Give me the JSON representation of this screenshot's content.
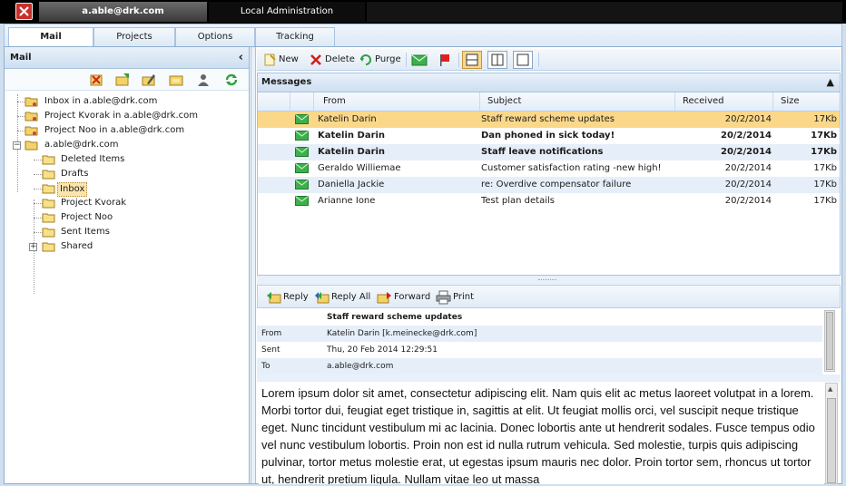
{
  "topbar": {
    "user": "a.able@drk.com",
    "admin": "Local Administration"
  },
  "tabs": [
    {
      "label": "Mail",
      "active": true
    },
    {
      "label": "Projects",
      "active": false
    },
    {
      "label": "Options",
      "active": false
    },
    {
      "label": "Tracking",
      "active": false
    }
  ],
  "left_panel": {
    "title": "Mail",
    "tree": [
      {
        "label": "Inbox in a.able@drk.com",
        "level": 0
      },
      {
        "label": "Project Kvorak in a.able@drk.com",
        "level": 0
      },
      {
        "label": "Project Noo in a.able@drk.com",
        "level": 0
      },
      {
        "label": "a.able@drk.com",
        "level": 0,
        "expanded": true
      },
      {
        "label": "Deleted Items",
        "level": 1
      },
      {
        "label": "Drafts",
        "level": 1
      },
      {
        "label": "Inbox",
        "level": 1,
        "selected": true
      },
      {
        "label": "Project Kvorak",
        "level": 1
      },
      {
        "label": "Project Noo",
        "level": 1
      },
      {
        "label": "Sent Items",
        "level": 1
      },
      {
        "label": "Shared",
        "level": 1,
        "collapsed": true
      }
    ]
  },
  "toolbar": {
    "new": "New",
    "delete": "Delete",
    "purge": "Purge"
  },
  "messages": {
    "title": "Messages",
    "columns": {
      "from": "From",
      "subject": "Subject",
      "received": "Received",
      "size": "Size"
    },
    "rows": [
      {
        "from": "Katelin Darin",
        "subject": "Staff reward scheme updates",
        "received": "20/2/2014",
        "size": "17Kb",
        "selected": true,
        "bold": false
      },
      {
        "from": "Katelin Darin",
        "subject": "Dan phoned in sick today!",
        "received": "20/2/2014",
        "size": "17Kb",
        "selected": false,
        "bold": true
      },
      {
        "from": "Katelin Darin",
        "subject": "Staff leave notifications",
        "received": "20/2/2014",
        "size": "17Kb",
        "selected": false,
        "bold": true
      },
      {
        "from": "Geraldo Williemae",
        "subject": "Customer satisfaction rating -new high!",
        "received": "20/2/2014",
        "size": "17Kb",
        "selected": false,
        "bold": false
      },
      {
        "from": "Daniella Jackie",
        "subject": "re: Overdive compensator failure",
        "received": "20/2/2014",
        "size": "17Kb",
        "selected": false,
        "bold": false
      },
      {
        "from": "Arianne Ione",
        "subject": "Test plan details",
        "received": "20/2/2014",
        "size": "17Kb",
        "selected": false,
        "bold": false
      }
    ]
  },
  "reading": {
    "reply": "Reply",
    "reply_all": "Reply All",
    "forward": "Forward",
    "print": "Print",
    "subject": "Staff reward scheme updates",
    "from_label": "From",
    "from_value": "Katelin Darin  [k.meinecke@drk.com]",
    "sent_label": "Sent",
    "sent_value": "Thu, 20 Feb 2014 12:29:51",
    "to_label": "To",
    "to_value": "a.able@drk.com",
    "body": "Lorem ipsum dolor sit amet, consectetur adipiscing elit. Nam quis elit ac metus laoreet volutpat in a lorem. Morbi tortor dui, feugiat eget tristique in, sagittis at elit. Ut feugiat mollis orci, vel suscipit neque tristique eget. Nunc tincidunt vestibulum mi ac lacinia. Donec lobortis ante ut hendrerit sodales. Fusce tempus odio vel nunc vestibulum lobortis. Proin non est id nulla rutrum vehicula. Sed molestie, turpis quis adipiscing pulvinar, tortor metus molestie erat, ut egestas ipsum mauris nec dolor. Proin tortor sem, rhoncus ut tortor ut, hendrerit pretium ligula. Nullam vitae leo ut massa"
  }
}
